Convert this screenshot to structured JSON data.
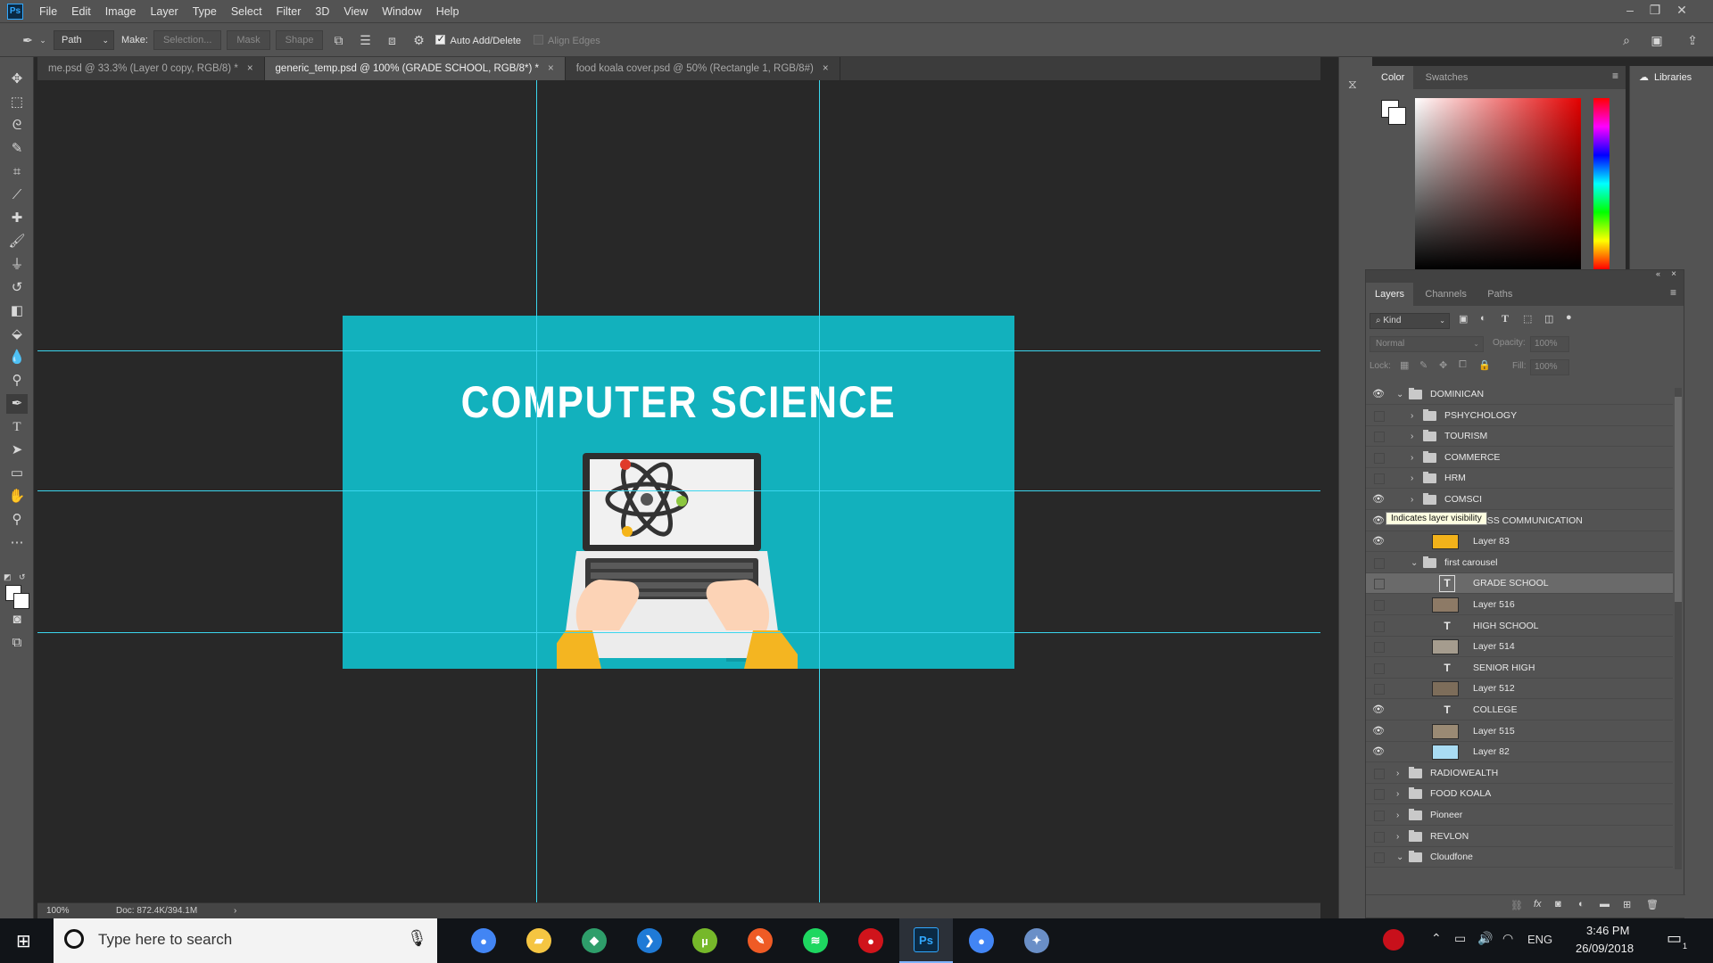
{
  "app": {
    "logo": "Ps",
    "menu": [
      "File",
      "Edit",
      "Image",
      "Layer",
      "Type",
      "Select",
      "Filter",
      "3D",
      "View",
      "Window",
      "Help"
    ],
    "window_controls": [
      "minimize-icon",
      "restore-icon",
      "close-icon"
    ]
  },
  "options_bar": {
    "tool_mode": "Path",
    "make_label": "Make:",
    "selection_btn": "Selection...",
    "mask_btn": "Mask",
    "shape_btn": "Shape",
    "auto_add_delete": "Auto Add/Delete",
    "auto_add_delete_checked": true,
    "align_edges": "Align Edges",
    "align_edges_checked": false
  },
  "tabs": [
    {
      "label": "me.psd @ 33.3% (Layer 0 copy, RGB/8) *",
      "active": false
    },
    {
      "label": "generic_temp.psd @ 100% (GRADE SCHOOL, RGB/8*) *",
      "active": true
    },
    {
      "label": "food koala cover.psd @ 50% (Rectangle 1, RGB/8#)",
      "active": false
    }
  ],
  "artwork": {
    "title": "COMPUTER SCIENCE",
    "background": "#12b1bd"
  },
  "status": {
    "zoom": "100%",
    "doc": "Doc: 872.4K/394.1M"
  },
  "color_panel": {
    "tabs": [
      "Color",
      "Swatches"
    ],
    "active_tab": "Color"
  },
  "libraries": {
    "label": "Libraries"
  },
  "layers_panel": {
    "tabs": [
      "Layers",
      "Channels",
      "Paths"
    ],
    "active_tab": "Layers",
    "filter_kind": "Kind",
    "blend_mode": "Normal",
    "opacity_label": "Opacity:",
    "opacity_value": "100%",
    "lock_label": "Lock:",
    "fill_label": "Fill:",
    "fill_value": "100%",
    "tooltip": "Indicates layer visibility",
    "layers": [
      {
        "name": "DOMINICAN",
        "kind": "group",
        "depth": 0,
        "visible": true,
        "expanded": true
      },
      {
        "name": "PSHYCHOLOGY",
        "kind": "group",
        "depth": 1,
        "visible": false,
        "expanded": false
      },
      {
        "name": "TOURISM",
        "kind": "group",
        "depth": 1,
        "visible": false,
        "expanded": false
      },
      {
        "name": "COMMERCE",
        "kind": "group",
        "depth": 1,
        "visible": false,
        "expanded": false
      },
      {
        "name": "HRM",
        "kind": "group",
        "depth": 1,
        "visible": false,
        "expanded": false
      },
      {
        "name": "COMSCI",
        "kind": "group",
        "depth": 1,
        "visible": true,
        "expanded": false
      },
      {
        "name": "MASS COMMUNICATION",
        "kind": "text",
        "depth": 2,
        "visible": true
      },
      {
        "name": "Layer 83",
        "kind": "pixel",
        "depth": 2,
        "visible": true,
        "thumb": "#f2b21a"
      },
      {
        "name": "first carousel",
        "kind": "group",
        "depth": 1,
        "visible": false,
        "expanded": true
      },
      {
        "name": "GRADE SCHOOL",
        "kind": "text",
        "depth": 2,
        "visible": false,
        "selected": true
      },
      {
        "name": "Layer 516",
        "kind": "pixel",
        "depth": 2,
        "visible": false,
        "thumb": "#8d7a66"
      },
      {
        "name": "HIGH SCHOOL",
        "kind": "text",
        "depth": 2,
        "visible": false
      },
      {
        "name": "Layer 514",
        "kind": "pixel",
        "depth": 2,
        "visible": false,
        "thumb": "#a59c8e"
      },
      {
        "name": "SENIOR HIGH",
        "kind": "text",
        "depth": 2,
        "visible": false
      },
      {
        "name": "Layer 512",
        "kind": "pixel",
        "depth": 2,
        "visible": false,
        "thumb": "#7d6d5a"
      },
      {
        "name": "COLLEGE",
        "kind": "text",
        "depth": 2,
        "visible": true
      },
      {
        "name": "Layer 515",
        "kind": "pixel",
        "depth": 2,
        "visible": true,
        "thumb": "#9a8a74"
      },
      {
        "name": "Layer 82",
        "kind": "pixel",
        "depth": 2,
        "visible": true,
        "thumb": "#a9dcf3"
      },
      {
        "name": "RADIOWEALTH",
        "kind": "group",
        "depth": 0,
        "visible": false,
        "expanded": false
      },
      {
        "name": "FOOD KOALA",
        "kind": "group",
        "depth": 0,
        "visible": false,
        "expanded": false
      },
      {
        "name": "Pioneer",
        "kind": "group",
        "depth": 0,
        "visible": false,
        "expanded": false
      },
      {
        "name": "REVLON",
        "kind": "group",
        "depth": 0,
        "visible": false,
        "expanded": false
      },
      {
        "name": "Cloudfone",
        "kind": "group",
        "depth": 0,
        "visible": false,
        "expanded": true
      }
    ]
  },
  "taskbar": {
    "search_placeholder": "Type here to search",
    "apps": [
      {
        "name": "chrome",
        "color": "#4285f4",
        "glyph": "●"
      },
      {
        "name": "file-explorer",
        "color": "#f5c542",
        "glyph": "▰"
      },
      {
        "name": "gitkraken",
        "color": "#2e9e6a",
        "glyph": "◆"
      },
      {
        "name": "vscode",
        "color": "#1f7ad6",
        "glyph": "❯"
      },
      {
        "name": "utorrent",
        "color": "#76b82a",
        "glyph": "µ"
      },
      {
        "name": "postman",
        "color": "#ef5b25",
        "glyph": "✎"
      },
      {
        "name": "spotify",
        "color": "#1ed760",
        "glyph": "≋"
      },
      {
        "name": "security-app",
        "color": "#d0141b",
        "glyph": "●"
      },
      {
        "name": "photoshop",
        "color": "#0b2a44",
        "glyph": "Ps"
      },
      {
        "name": "chrome-2",
        "color": "#4285f4",
        "glyph": "●"
      },
      {
        "name": "paint-app",
        "color": "#6a8fc7",
        "glyph": "✦"
      }
    ],
    "language": "ENG",
    "time": "3:46 PM",
    "date": "26/09/2018",
    "notification_count": "1"
  }
}
